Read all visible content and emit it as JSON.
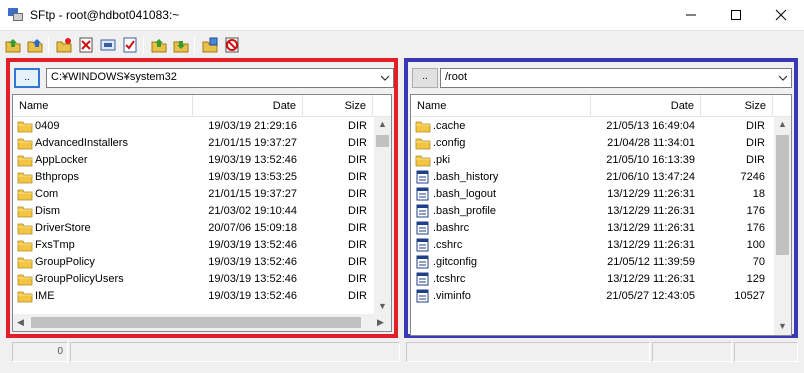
{
  "window": {
    "title": "SFtp - root@hdbot041083:~",
    "minimize_glyph": "—",
    "maximize_glyph": "☐",
    "close_glyph": "✕"
  },
  "toolbar": {
    "buttons": [
      {
        "icon": "upload-icon"
      },
      {
        "icon": "download-icon"
      },
      {
        "icon": "new-folder-icon"
      },
      {
        "icon": "delete-icon"
      },
      {
        "icon": "rename-icon"
      },
      {
        "icon": "select-all-icon"
      },
      {
        "icon": "sync-left-icon"
      },
      {
        "icon": "sync-right-icon"
      },
      {
        "icon": "properties-icon"
      },
      {
        "icon": "cancel-icon"
      }
    ]
  },
  "left_pane": {
    "updir_label": "..",
    "path": "C:¥WINDOWS¥system32",
    "columns": {
      "name": "Name",
      "date": "Date",
      "size": "Size"
    },
    "rows": [
      {
        "name": "0409",
        "date": "19/03/19 21:29:16",
        "size": "DIR",
        "type": "folder"
      },
      {
        "name": "AdvancedInstallers",
        "date": "21/01/15 19:37:27",
        "size": "DIR",
        "type": "folder"
      },
      {
        "name": "AppLocker",
        "date": "19/03/19 13:52:46",
        "size": "DIR",
        "type": "folder"
      },
      {
        "name": "Bthprops",
        "date": "19/03/19 13:53:25",
        "size": "DIR",
        "type": "folder"
      },
      {
        "name": "Com",
        "date": "21/01/15 19:37:27",
        "size": "DIR",
        "type": "folder"
      },
      {
        "name": "Dism",
        "date": "21/03/02 19:10:44",
        "size": "DIR",
        "type": "folder"
      },
      {
        "name": "DriverStore",
        "date": "20/07/06 15:09:18",
        "size": "DIR",
        "type": "folder"
      },
      {
        "name": "FxsTmp",
        "date": "19/03/19 13:52:46",
        "size": "DIR",
        "type": "folder"
      },
      {
        "name": "GroupPolicy",
        "date": "19/03/19 13:52:46",
        "size": "DIR",
        "type": "folder"
      },
      {
        "name": "GroupPolicyUsers",
        "date": "19/03/19 13:52:46",
        "size": "DIR",
        "type": "folder"
      },
      {
        "name": "IME",
        "date": "19/03/19 13:52:46",
        "size": "DIR",
        "type": "folder"
      }
    ]
  },
  "right_pane": {
    "updir_label": "..",
    "path": "/root",
    "columns": {
      "name": "Name",
      "date": "Date",
      "size": "Size"
    },
    "rows": [
      {
        "name": ".cache",
        "date": "21/05/13 16:49:04",
        "size": "DIR",
        "type": "folder"
      },
      {
        "name": ".config",
        "date": "21/04/28 11:34:01",
        "size": "DIR",
        "type": "folder"
      },
      {
        "name": ".pki",
        "date": "21/05/10 16:13:39",
        "size": "DIR",
        "type": "folder"
      },
      {
        "name": ".bash_history",
        "date": "21/06/10 13:47:24",
        "size": "7246",
        "type": "file"
      },
      {
        "name": ".bash_logout",
        "date": "13/12/29 11:26:31",
        "size": "18",
        "type": "file"
      },
      {
        "name": ".bash_profile",
        "date": "13/12/29 11:26:31",
        "size": "176",
        "type": "file"
      },
      {
        "name": ".bashrc",
        "date": "13/12/29 11:26:31",
        "size": "176",
        "type": "file"
      },
      {
        "name": ".cshrc",
        "date": "13/12/29 11:26:31",
        "size": "100",
        "type": "file"
      },
      {
        "name": ".gitconfig",
        "date": "21/05/12 11:39:59",
        "size": "70",
        "type": "file"
      },
      {
        "name": ".tcshrc",
        "date": "13/12/29 11:26:31",
        "size": "129",
        "type": "file"
      },
      {
        "name": ".viminfo",
        "date": "21/05/27 12:43:05",
        "size": "10527",
        "type": "file"
      }
    ]
  },
  "status": {
    "left_count": "0"
  },
  "colors": {
    "left_highlight": "#e01f26",
    "right_highlight": "#3a38b5",
    "folder": "#f4c542"
  }
}
